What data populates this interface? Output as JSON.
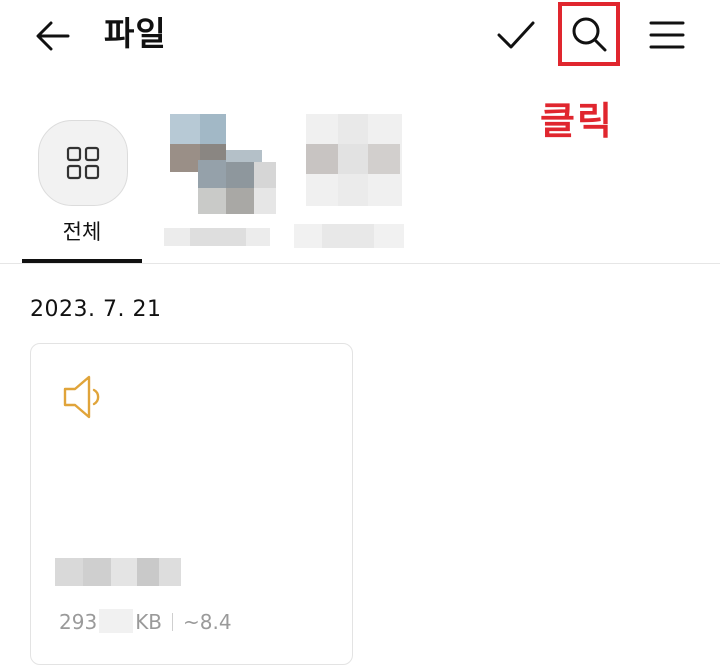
{
  "header": {
    "title": "파일",
    "icons": {
      "back": "arrow-left-icon",
      "select": "check-icon",
      "search": "search-icon",
      "menu": "hamburger-menu-icon"
    },
    "highlight_color": "#e0262e"
  },
  "annotation": {
    "text": "클릭"
  },
  "categories": [
    {
      "label": "전체",
      "selected": true,
      "icon": "grid-icon"
    },
    {
      "label": "",
      "blurred": true
    },
    {
      "label": "",
      "blurred": true
    }
  ],
  "sections": [
    {
      "date": "2023. 7. 21",
      "files": [
        {
          "type_icon": "audio-speaker-icon",
          "name": "",
          "size_prefix": "293",
          "size_unit": "KB",
          "duration": "~8.4",
          "icon_color": "#e0a43a"
        }
      ]
    }
  ]
}
